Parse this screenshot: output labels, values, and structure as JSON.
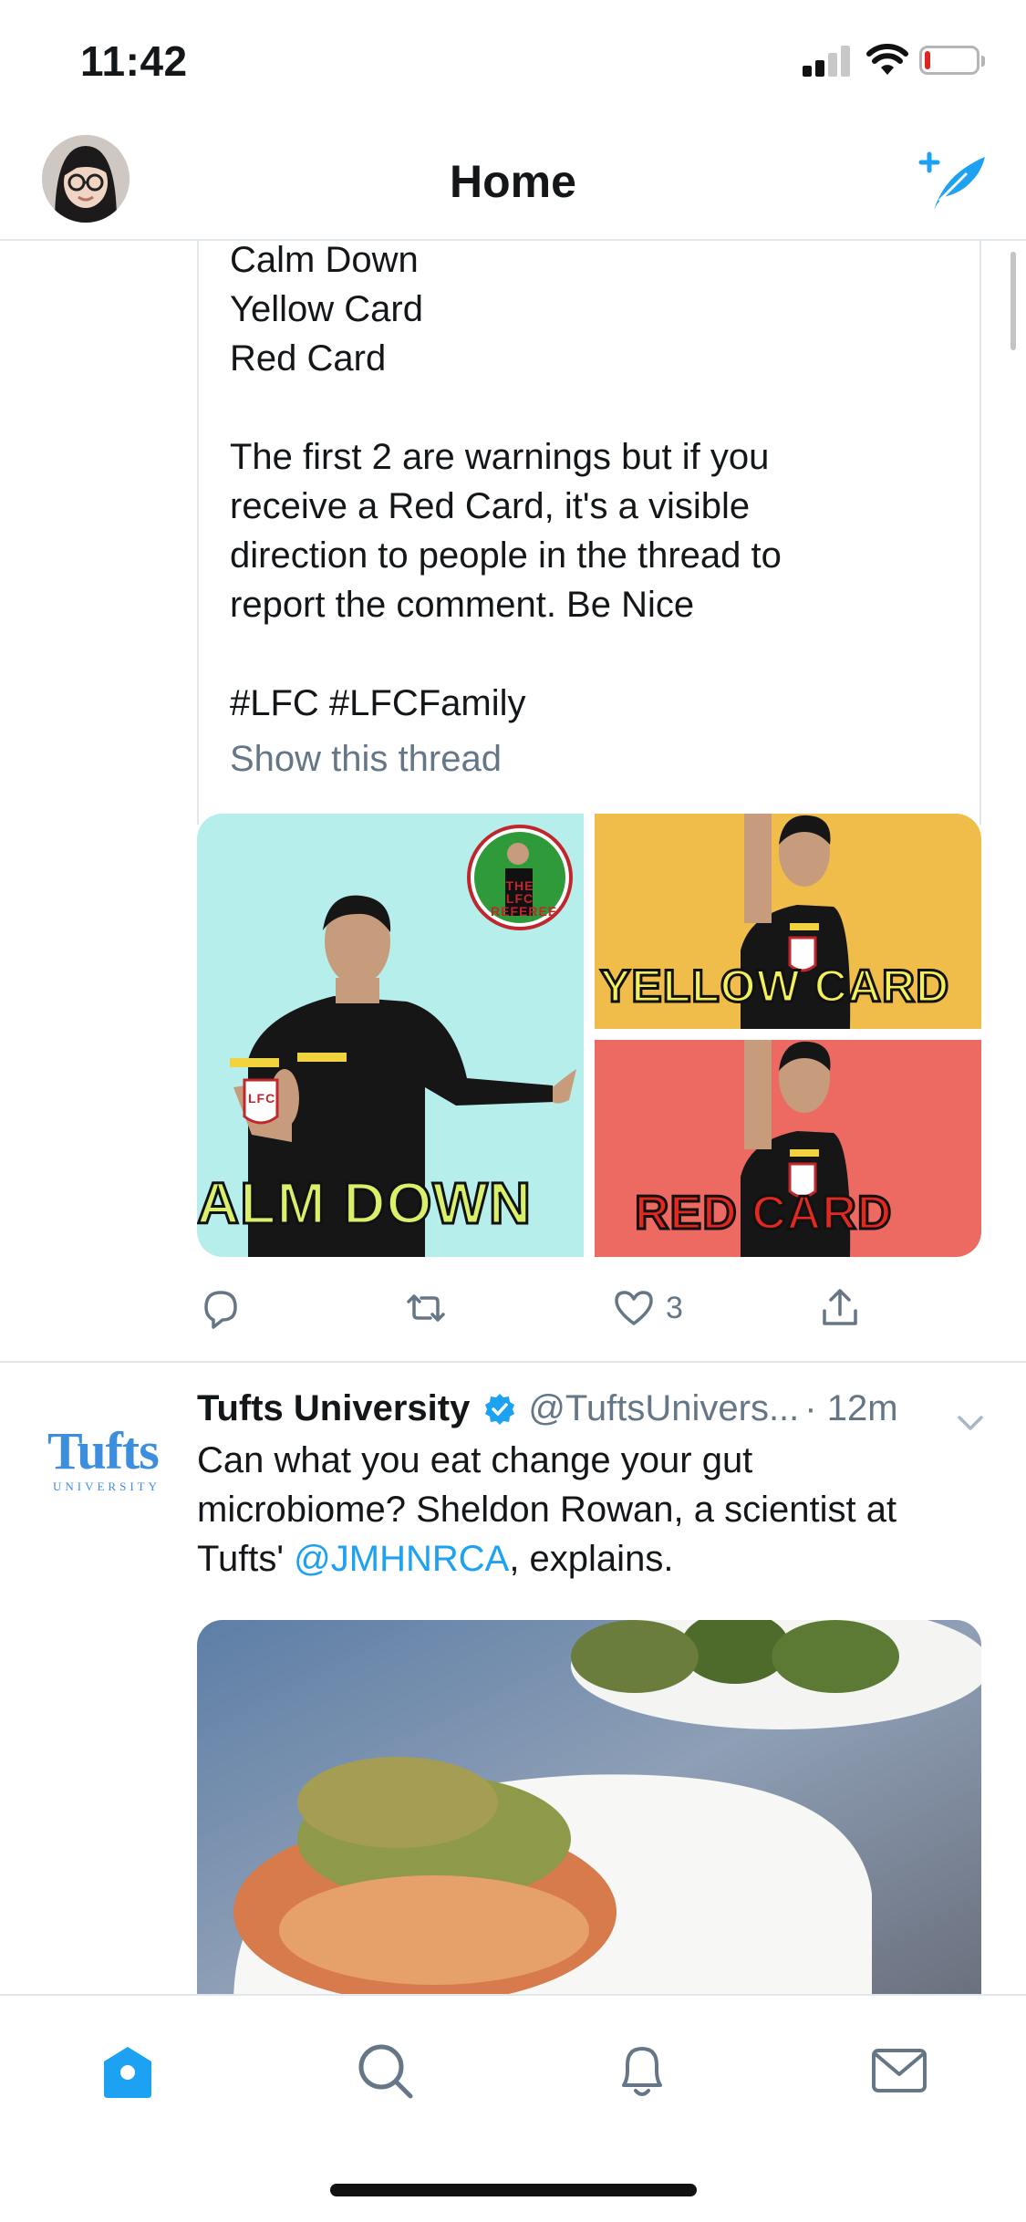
{
  "status_bar": {
    "time": "11:42"
  },
  "header": {
    "title": "Home"
  },
  "tweet1": {
    "text_lines": [
      "Calm Down",
      "Yellow Card",
      "Red Card"
    ],
    "paragraph": "The first 2 are warnings but if you\nreceive a Red Card, it's a visible\ndirection to people in the thread to\nreport the comment. Be Nice",
    "hashtags": "#LFC #LFCFamily",
    "show_thread": "Show this thread",
    "media": {
      "tile1_text": "ALM DOWN",
      "tile2_text": "YELLOW CARD",
      "tile3_text": "RED CARD",
      "badge_text": "LFC",
      "logo_text": "THE LFC REFEREE",
      "colors": {
        "cyan": "#b6eeec",
        "yellow": "#f0bd4b",
        "red": "#ed6a63"
      }
    },
    "like_count": "3"
  },
  "tweet2": {
    "name": "Tufts University",
    "handle": "@TuftsUnivers...",
    "time": "· 12m",
    "logo_word": "Tufts",
    "logo_sub": "UNIVERSITY",
    "text_before": "Can what you eat change your gut\nmicrobiome? Sheldon Rowan, a scientist at\nTufts' ",
    "mention": "@JMHNRCA",
    "text_after": ", explains."
  },
  "tabs": [
    "home-icon",
    "search-icon",
    "notifications-icon",
    "messages-icon"
  ],
  "accent": "#1da1f2"
}
